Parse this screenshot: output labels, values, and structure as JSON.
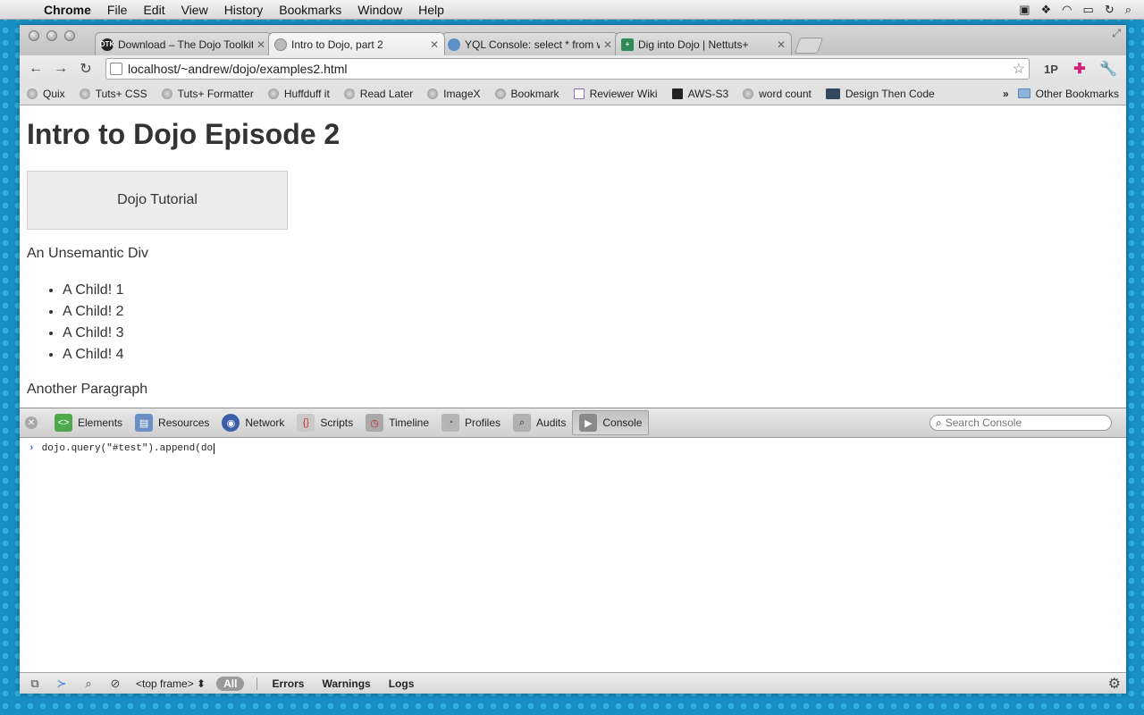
{
  "menubar": {
    "apple": "",
    "app_name": "Chrome",
    "items": [
      "File",
      "Edit",
      "View",
      "History",
      "Bookmarks",
      "Window",
      "Help"
    ]
  },
  "tabs": [
    {
      "title": "Download – The Dojo Toolkit",
      "favicon_color": "#222",
      "favicon_text": "DTK"
    },
    {
      "title": "Intro to Dojo, part 2",
      "favicon_color": "#aaa",
      "favicon_text": ""
    },
    {
      "title": "YQL Console: select * from w",
      "favicon_color": "#5b8fc7",
      "favicon_text": ""
    },
    {
      "title": "Dig into Dojo | Nettuts+",
      "favicon_color": "#2e8b57",
      "favicon_text": "+"
    }
  ],
  "omnibox": {
    "url": "localhost/~andrew/dojo/examples2.html"
  },
  "extensions": {
    "onepassword": "1P"
  },
  "bookmarks": {
    "items": [
      "Quix",
      "Tuts+ CSS",
      "Tuts+ Formatter",
      "Huffduff it",
      "Read Later",
      "ImageX",
      "Bookmark",
      "Reviewer Wiki",
      "AWS-S3",
      "word count",
      "Design Then Code"
    ],
    "more": "»",
    "other": "Other Bookmarks"
  },
  "page": {
    "heading": "Intro to Dojo Episode 2",
    "box_text": "Dojo Tutorial",
    "unsemantic": "An Unsemantic Div",
    "list": [
      "A Child! 1",
      "A Child! 2",
      "A Child! 3",
      "A Child! 4"
    ],
    "paragraph": "Another Paragraph"
  },
  "devtools": {
    "panels": [
      "Elements",
      "Resources",
      "Network",
      "Scripts",
      "Timeline",
      "Profiles",
      "Audits",
      "Console"
    ],
    "active_panel": "Console",
    "search_placeholder": "Search Console",
    "console_input": "dojo.query(\"#test\").append(do",
    "frame": "<top frame>",
    "filters": {
      "all": "All",
      "errors": "Errors",
      "warnings": "Warnings",
      "logs": "Logs"
    }
  }
}
